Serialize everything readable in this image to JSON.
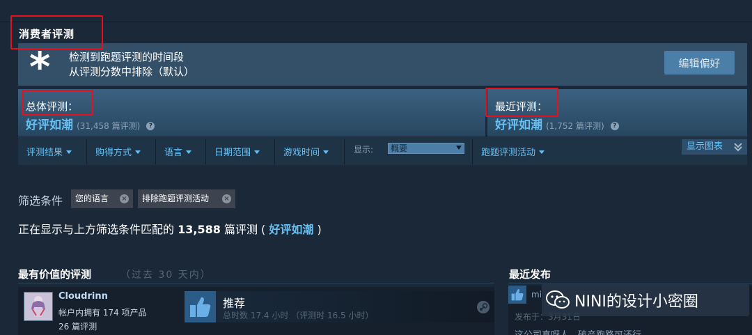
{
  "section": {
    "title": "消费者评测"
  },
  "notice": {
    "line1": "检测到跑题评测的时间段",
    "line2": "从评测分数中排除（默认）",
    "edit_button": "编辑偏好"
  },
  "summary": {
    "overall": {
      "label": "总体评测：",
      "score": "好评如潮",
      "count": "(31,458 篇评测)"
    },
    "recent": {
      "label": "最近评测：",
      "score": "好评如潮",
      "count": "(1,752 篇评测)"
    },
    "help_glyph": "?"
  },
  "filterbar": {
    "items": [
      "评测结果",
      "购得方式",
      "语言",
      "日期范围",
      "游戏时间"
    ],
    "display_label": "显示:",
    "display_value": "概要",
    "offtopic": "跑题评测活动",
    "graph_button": "显示图表"
  },
  "filters": {
    "label": "筛选条件",
    "chips": [
      "您的语言",
      "排除跑题评测活动"
    ],
    "chip_close": "×"
  },
  "showing": {
    "prefix": "正在显示与上方筛选条件匹配的",
    "count": "13,588",
    "suffix": "篇评测 (",
    "rating": "好评如潮",
    "close": ")"
  },
  "helpful": {
    "title": "最有价值的评测",
    "subtitle": "（过去 30 天内）",
    "review": {
      "name": "Cloudrinn",
      "owned": "帐户内拥有 174 项产品",
      "reviews": "26 篇评测",
      "verdict": "推荐",
      "hours": "总时数 17.4 小时 （评测时 16.5 小时）"
    }
  },
  "recent": {
    "title": "最近发布",
    "user": "mi",
    "date": "发布于：3月31日",
    "text": "这公司真呀人，破产跑路可还行"
  },
  "watermark": {
    "text": "NINI的设计小密圈"
  },
  "colors": {
    "accent": "#66c0f4",
    "background": "#1b2838",
    "highlight_box": "#e8101a"
  }
}
